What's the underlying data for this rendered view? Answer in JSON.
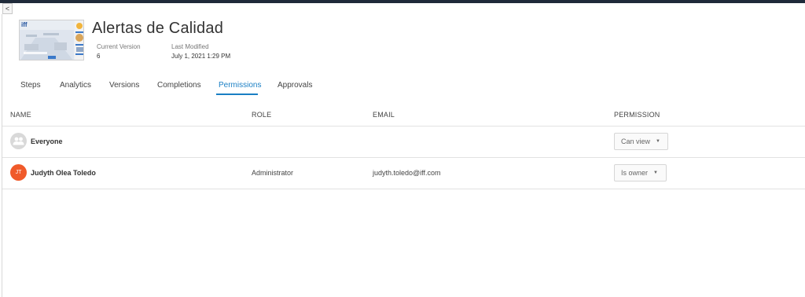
{
  "nav": {
    "back_glyph": "<"
  },
  "document": {
    "title": "Alertas de Calidad",
    "current_version_label": "Current Version",
    "current_version": "6",
    "last_modified_label": "Last Modified",
    "last_modified": "July 1, 2021 1:29 PM",
    "thumbnail_logo": "iff"
  },
  "tabs": [
    {
      "label": "Steps"
    },
    {
      "label": "Analytics"
    },
    {
      "label": "Versions"
    },
    {
      "label": "Completions"
    },
    {
      "label": "Permissions",
      "active": true
    },
    {
      "label": "Approvals"
    }
  ],
  "table": {
    "headers": {
      "name": "NAME",
      "role": "ROLE",
      "email": "EMAIL",
      "permission": "PERMISSION"
    },
    "rows": [
      {
        "name": "Everyone",
        "role": "",
        "email": "",
        "permission": "Can view",
        "avatar": "group-icon"
      },
      {
        "name": "Judyth Olea Toledo",
        "role": "Administrator",
        "email": "judyth.toledo@iff.com",
        "permission": "Is owner",
        "avatar_initials": "JT"
      }
    ]
  },
  "colors": {
    "accent": "#1a7fc4",
    "avatar_user": "#f05a2a",
    "topbar": "#1f2a3a"
  }
}
